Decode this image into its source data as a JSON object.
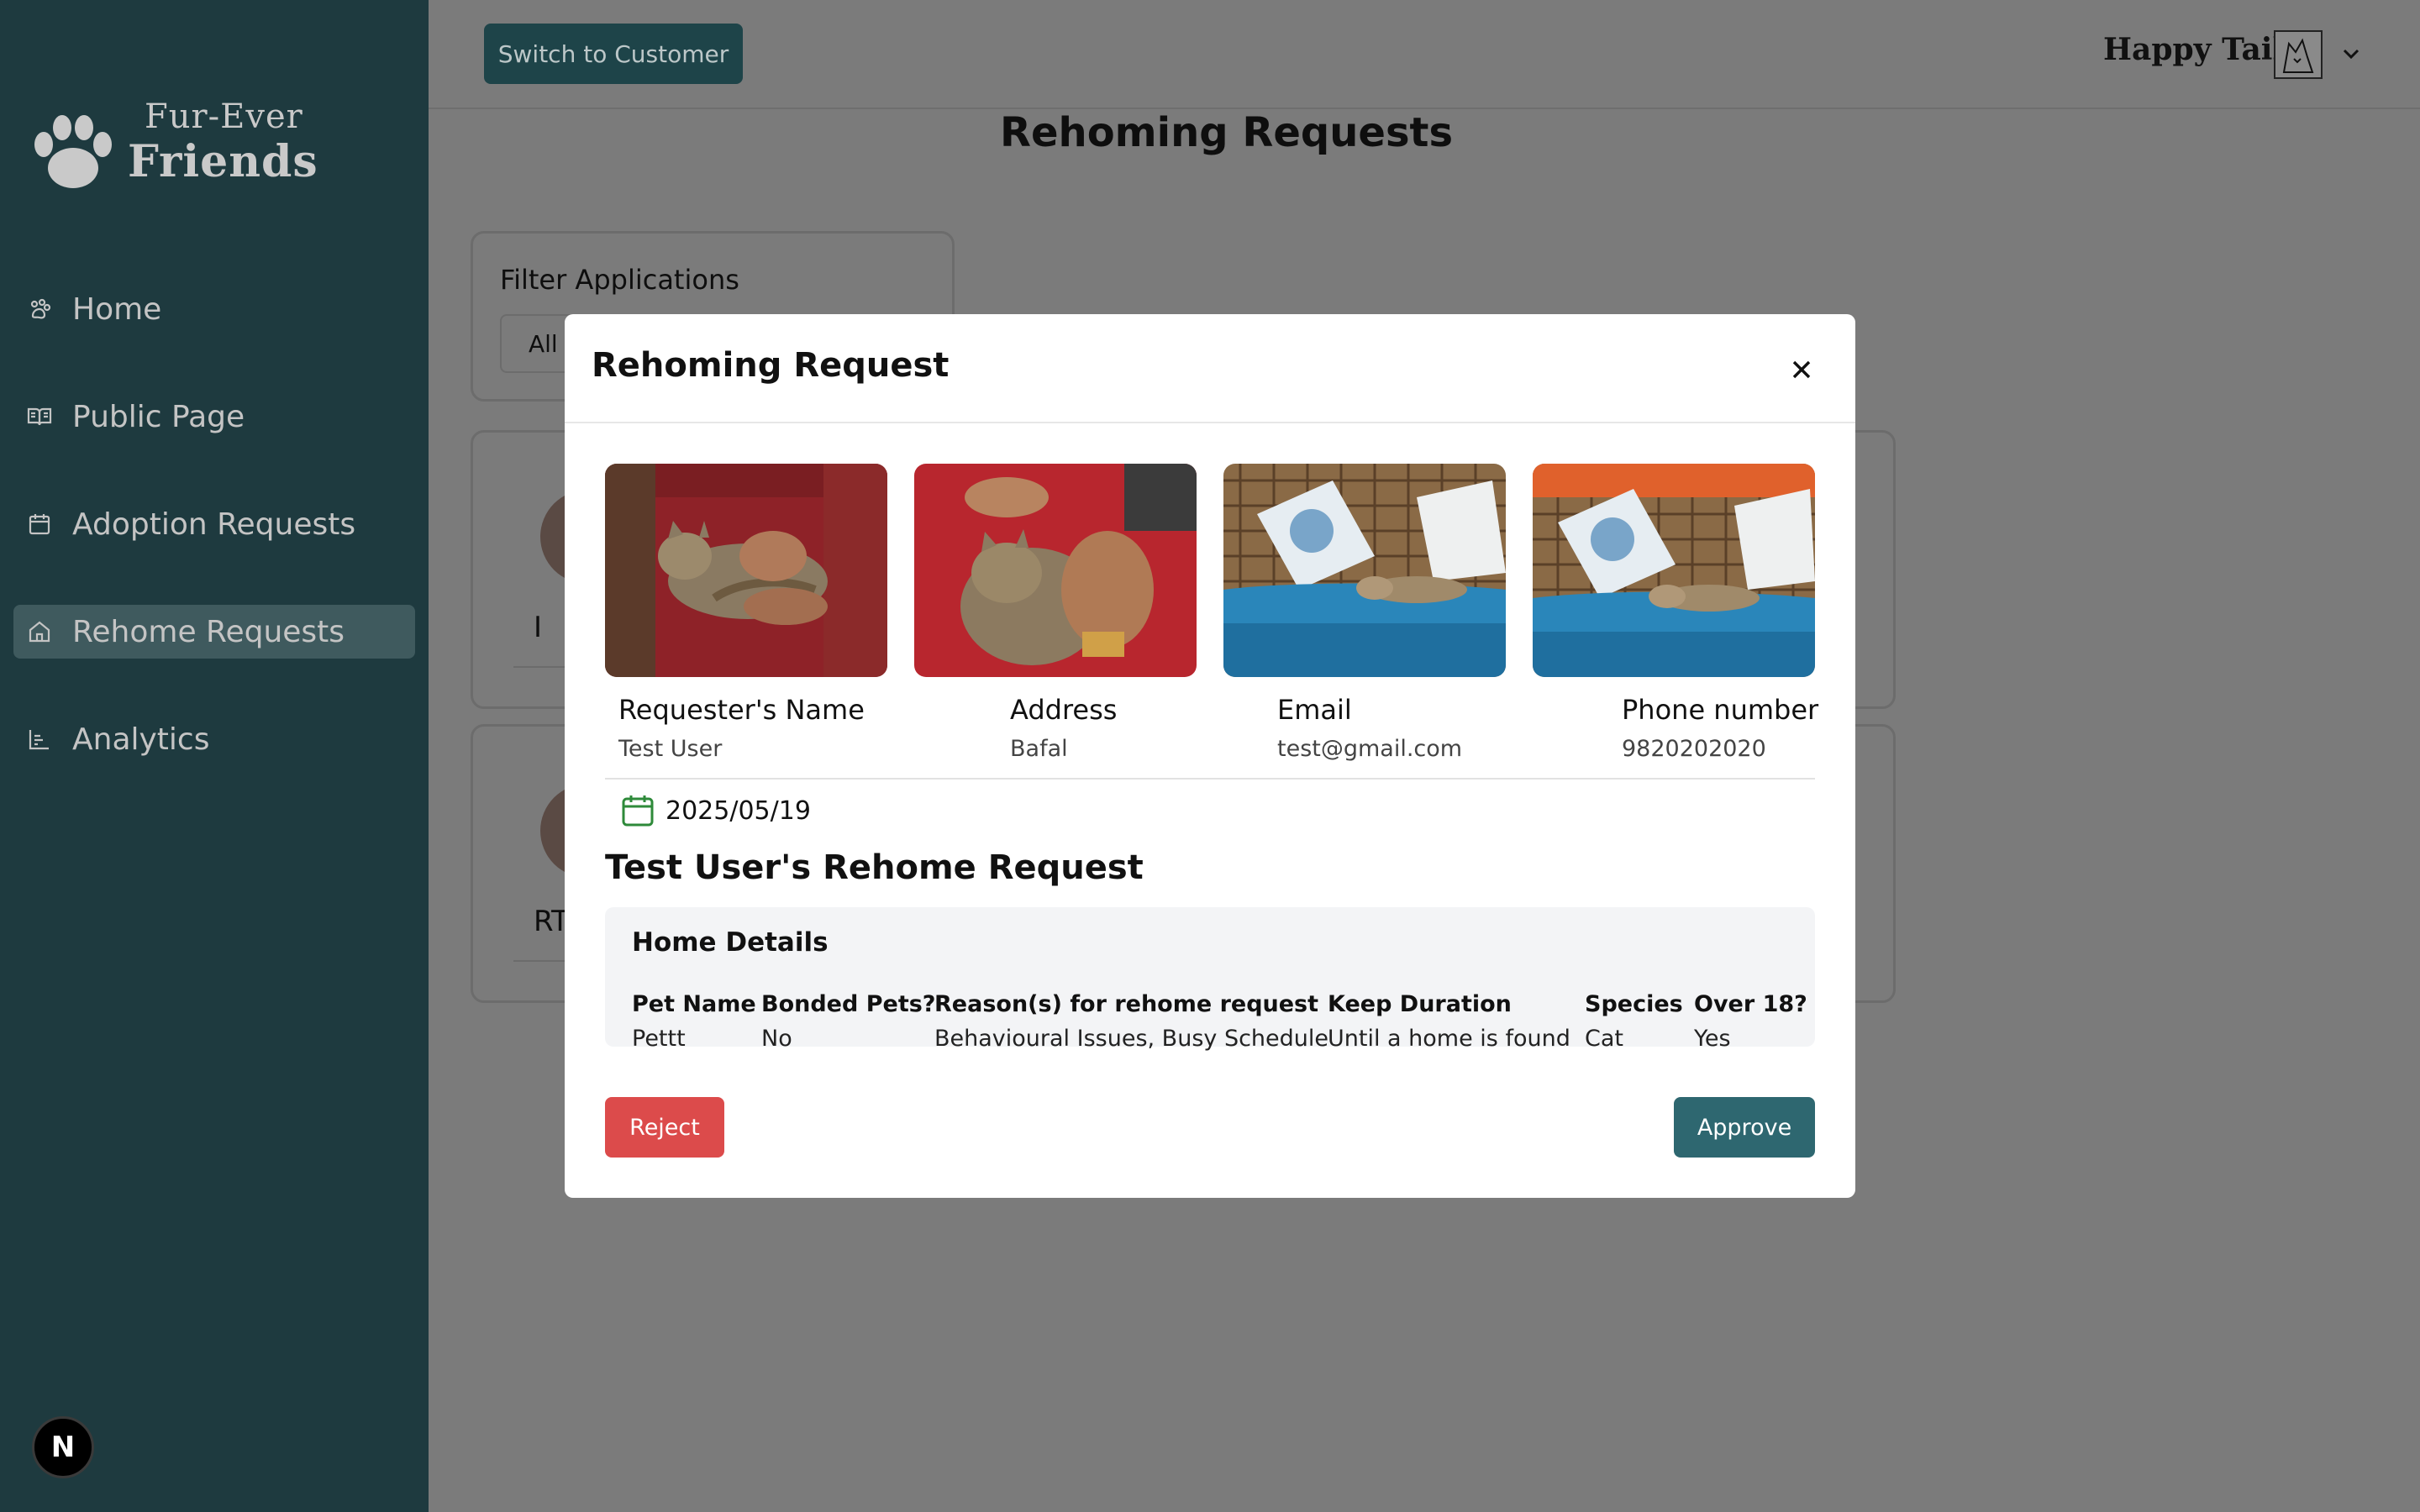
{
  "sidebar": {
    "logo_line1": "Fur-Ever",
    "logo_line2": "Friends",
    "items": [
      {
        "label": "Home",
        "icon": "paw-icon"
      },
      {
        "label": "Public Page",
        "icon": "book-open-icon"
      },
      {
        "label": "Adoption Requests",
        "icon": "calendar-icon"
      },
      {
        "label": "Rehome Requests",
        "icon": "house-icon",
        "active": true
      },
      {
        "label": "Analytics",
        "icon": "bar-chart-icon"
      }
    ],
    "dev_badge": "N"
  },
  "topbar": {
    "switch_label": "Switch to Customer",
    "org_name": "Happy Tails"
  },
  "page": {
    "title": "Rehoming Requests",
    "filter_label": "Filter Applications",
    "filter_value": "All S",
    "card1_name": "I",
    "card2_name": "RT"
  },
  "modal": {
    "title": "Rehoming Request",
    "info": {
      "name_label": "Requester's Name",
      "name_value": "Test User",
      "address_label": "Address",
      "address_value": "Bafal",
      "email_label": "Email",
      "email_value": "test@gmail.com",
      "phone_label": "Phone number",
      "phone_value": "9820202020"
    },
    "date": "2025/05/19",
    "request_title": "Test User's Rehome Request",
    "details": {
      "title": "Home Details",
      "columns": [
        {
          "label": "Pet Name",
          "value": "Pettt"
        },
        {
          "label": "Bonded Pets?",
          "value": "No"
        },
        {
          "label": "Reason(s) for rehome request",
          "value": "Behavioural Issues, Busy Schedule"
        },
        {
          "label": "Keep Duration",
          "value": "Until a home is found"
        },
        {
          "label": "Species",
          "value": "Cat"
        },
        {
          "label": "Over 18?",
          "value": "Yes"
        }
      ]
    },
    "reject_label": "Reject",
    "approve_label": "Approve"
  },
  "colors": {
    "sidebar_bg": "#1e3a3f",
    "accent": "#2e6770",
    "reject": "#dc4b4b",
    "overlay": "#7b7b7b"
  }
}
